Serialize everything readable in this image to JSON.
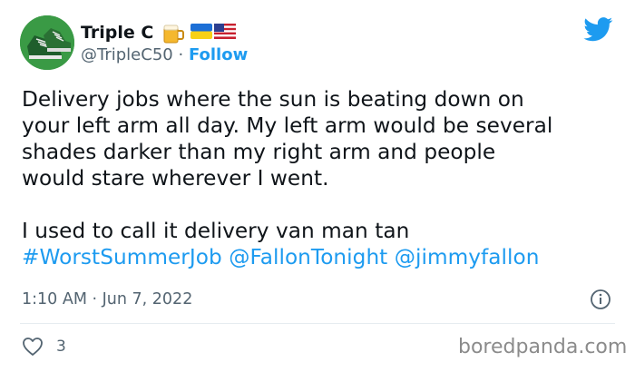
{
  "header": {
    "display_name": "Triple C",
    "handle": "@TripleC50",
    "separator": "·",
    "follow_label": "Follow",
    "emojis": [
      "beer-mug",
      "ukraine-flag",
      "us-flag"
    ]
  },
  "tweet": {
    "lines": [
      "Delivery jobs where the sun is beating down on",
      "your left arm all day. My left arm would be several",
      "shades darker than my right arm and people",
      "would stare wherever I went.",
      "I used to call it delivery van man tan"
    ],
    "links": [
      "#WorstSummerJob",
      "@FallonTonight",
      "@jimmyfallon"
    ]
  },
  "meta": {
    "timestamp": "1:10 AM · Jun 7, 2022"
  },
  "engagement": {
    "like_count": "3"
  },
  "watermark": "boredpanda.com",
  "colors": {
    "accent": "#1d9bf0",
    "text": "#0f1419",
    "muted": "#536471"
  }
}
